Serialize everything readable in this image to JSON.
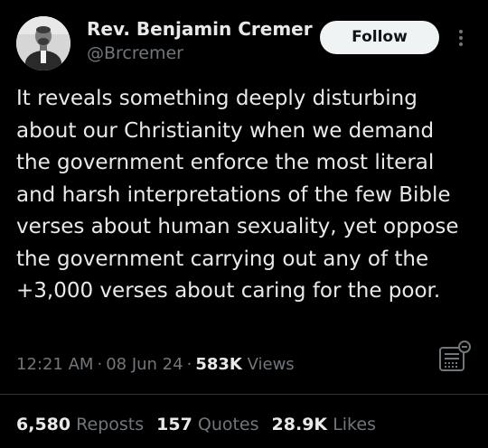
{
  "author": {
    "display_name": "Rev. Benjamin Cremer",
    "handle": "@Brcremer"
  },
  "follow_button": {
    "label": "Follow"
  },
  "tweet": {
    "text": "It reveals something deeply disturbing about our Christianity when we demand the government enforce the most literal and harsh interpretations of the few Bible verses about human sexuality, yet oppose the government carrying out any of the +3,000 verses about caring for the poor."
  },
  "meta": {
    "time": "12:21 AM",
    "separator": "·",
    "date": "08 Jun 24",
    "views_count": "583K",
    "views_label": "Views"
  },
  "stats": {
    "reposts_count": "6,580",
    "reposts_label": "Reposts",
    "quotes_count": "157",
    "quotes_label": "Quotes",
    "likes_count": "28.9K",
    "likes_label": "Likes"
  },
  "icons": {
    "more": "more-vertical-icon",
    "notes": "notes-icon"
  },
  "colors": {
    "background": "#000000",
    "primary_text": "#e7e9ea",
    "secondary_text": "#71767b",
    "follow_button_bg": "#eff3f4",
    "follow_button_text": "#0f1419",
    "divider": "#2f3336"
  }
}
